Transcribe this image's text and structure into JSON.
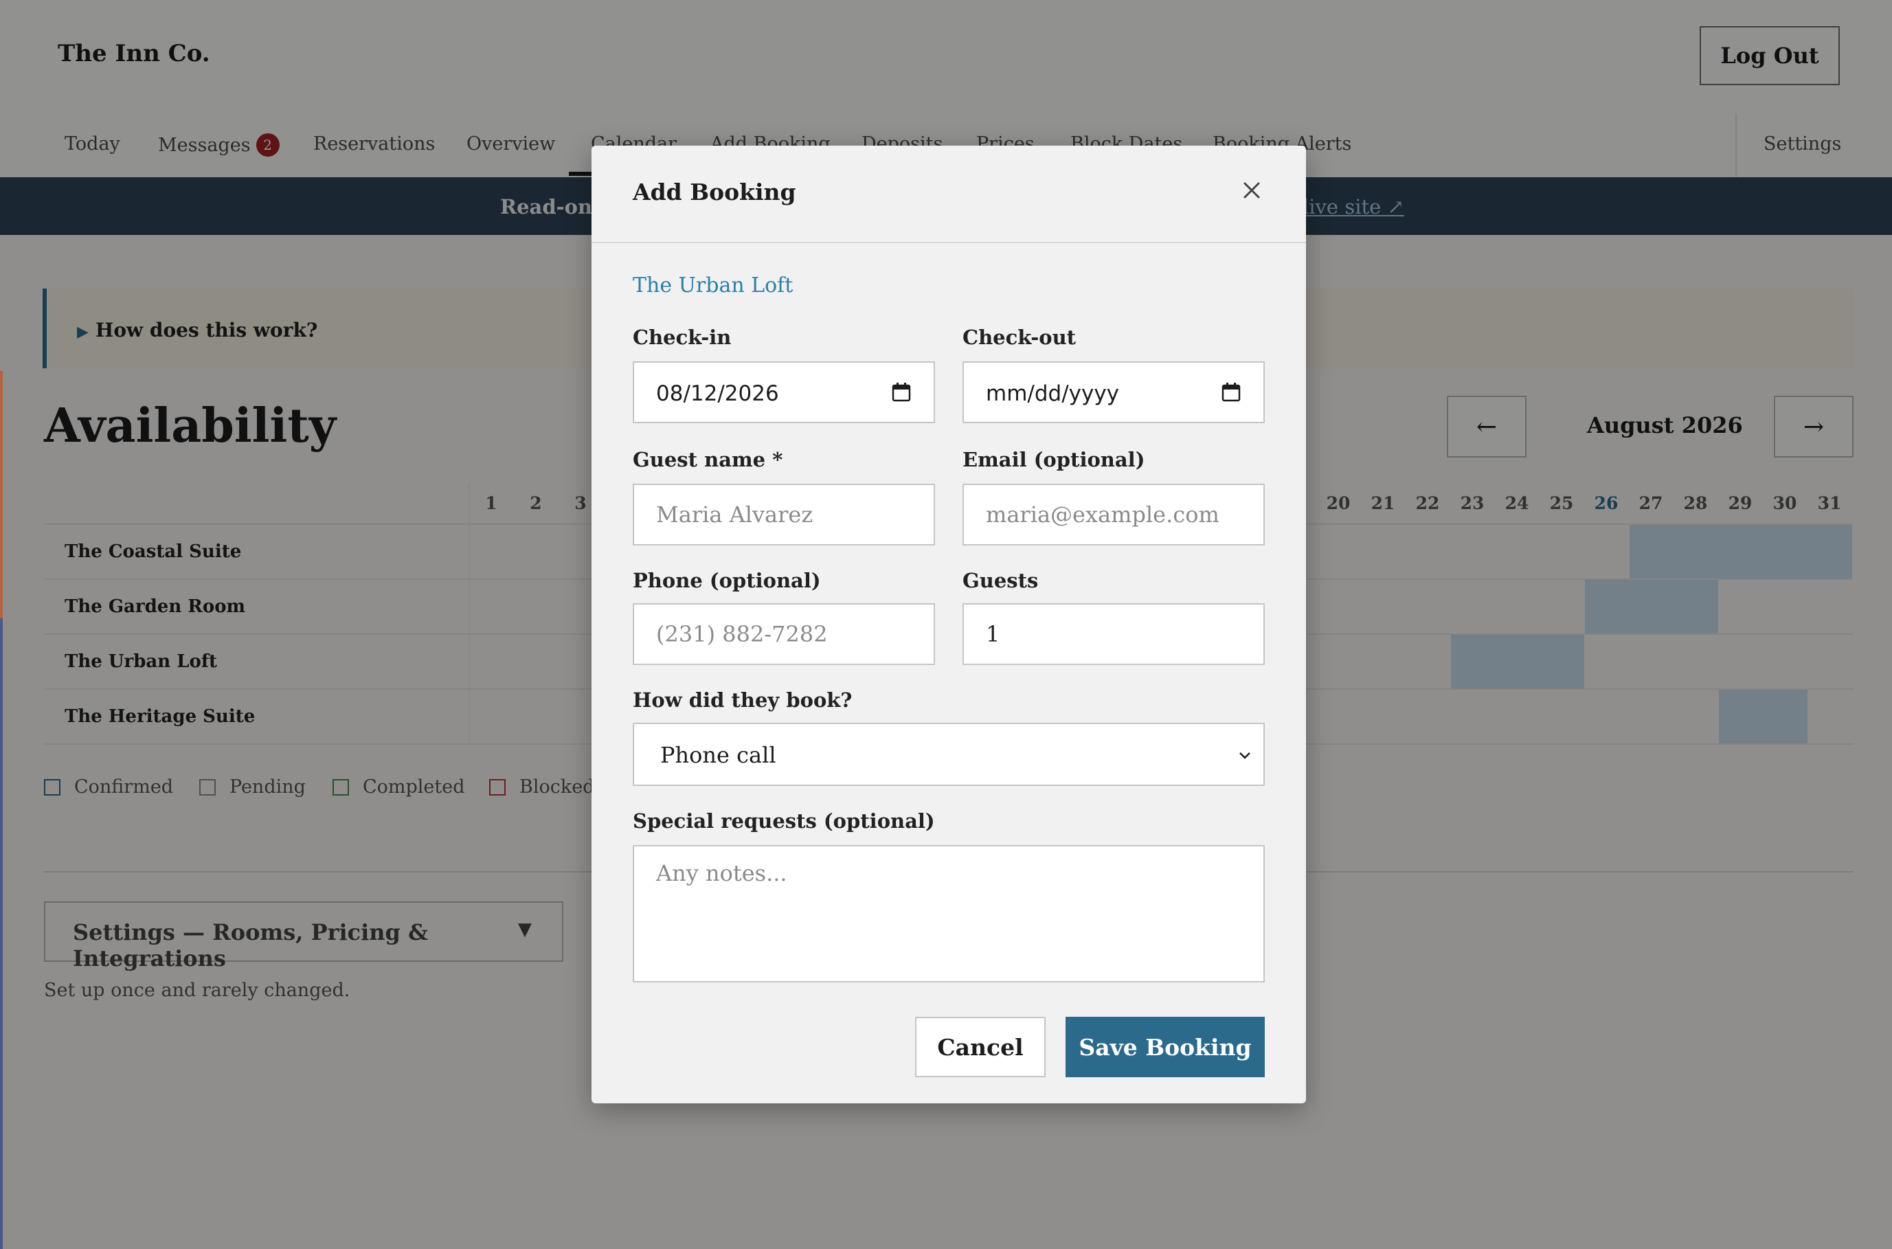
{
  "header": {
    "brand": "The Inn Co.",
    "logout_label": "Log Out"
  },
  "nav": {
    "items": [
      {
        "label": "Today"
      },
      {
        "label": "Messages",
        "badge": "2"
      },
      {
        "label": "Reservations"
      },
      {
        "label": "Overview"
      },
      {
        "label": "Calendar",
        "active": true
      },
      {
        "label": "Add Booking"
      },
      {
        "label": "Deposits"
      },
      {
        "label": "Prices"
      },
      {
        "label": "Block Dates"
      },
      {
        "label": "Booking Alerts"
      }
    ],
    "settings_label": "Settings"
  },
  "banner": {
    "text": "Read-only",
    "link_text": "live site ↗"
  },
  "help": {
    "summary": "How does this work?"
  },
  "availability": {
    "title": "Availability",
    "prev_label": "←",
    "next_label": "→",
    "month": "August 2026",
    "days": [
      "1",
      "2",
      "3",
      "20",
      "21",
      "22",
      "23",
      "24",
      "25",
      "26",
      "27",
      "28",
      "29",
      "30",
      "31"
    ],
    "today": "26",
    "rooms": [
      "The Coastal Suite",
      "The Garden Room",
      "The Urban Loft",
      "The Heritage Suite"
    ],
    "legend": [
      "Confirmed",
      "Pending",
      "Completed",
      "Blocked"
    ]
  },
  "settings_section": {
    "toggle_label": "Settings — Rooms, Pricing & Integrations",
    "arrow": "▼",
    "note": "Set up once and rarely changed."
  },
  "modal": {
    "title": "Add Booking",
    "room": "The Urban Loft",
    "checkin_label": "Check-in",
    "checkin_value": "08/12/2026",
    "checkout_label": "Check-out",
    "checkout_placeholder": "mm/dd/yyyy",
    "guest_name_label": "Guest name *",
    "guest_name_placeholder": "Maria Alvarez",
    "email_label": "Email (optional)",
    "email_placeholder": "maria@example.com",
    "phone_label": "Phone (optional)",
    "phone_placeholder": "(231) 882-7282",
    "guests_label": "Guests",
    "guests_value": "1",
    "source_label": "How did they book?",
    "source_value": "Phone call",
    "requests_label": "Special requests (optional)",
    "requests_placeholder": "Any notes...",
    "cancel_label": "Cancel",
    "save_label": "Save Booking"
  },
  "colors": {
    "accent": "#2b6a8b",
    "link": "#2d7ea6",
    "banner": "#2d4457",
    "badge": "#a32323",
    "booked_cell": "#c7dcec"
  }
}
